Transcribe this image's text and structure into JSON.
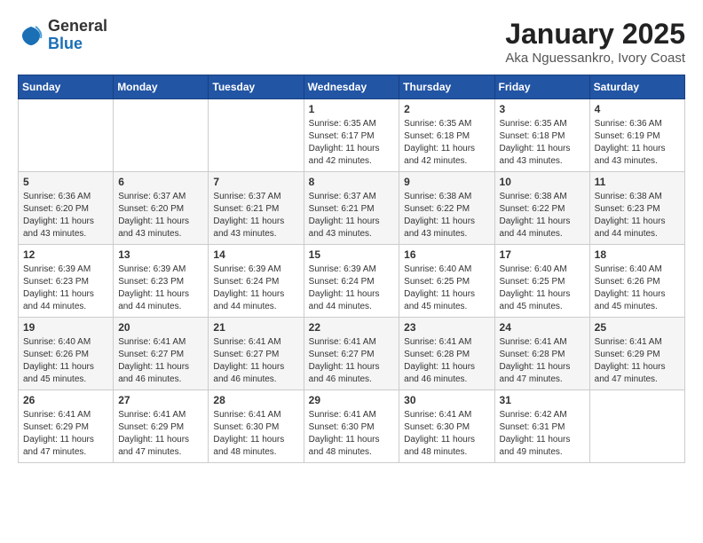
{
  "logo": {
    "general": "General",
    "blue": "Blue"
  },
  "title": "January 2025",
  "location": "Aka Nguessankro, Ivory Coast",
  "days_header": [
    "Sunday",
    "Monday",
    "Tuesday",
    "Wednesday",
    "Thursday",
    "Friday",
    "Saturday"
  ],
  "weeks": [
    [
      {
        "day": "",
        "info": ""
      },
      {
        "day": "",
        "info": ""
      },
      {
        "day": "",
        "info": ""
      },
      {
        "day": "1",
        "info": "Sunrise: 6:35 AM\nSunset: 6:17 PM\nDaylight: 11 hours\nand 42 minutes."
      },
      {
        "day": "2",
        "info": "Sunrise: 6:35 AM\nSunset: 6:18 PM\nDaylight: 11 hours\nand 42 minutes."
      },
      {
        "day": "3",
        "info": "Sunrise: 6:35 AM\nSunset: 6:18 PM\nDaylight: 11 hours\nand 43 minutes."
      },
      {
        "day": "4",
        "info": "Sunrise: 6:36 AM\nSunset: 6:19 PM\nDaylight: 11 hours\nand 43 minutes."
      }
    ],
    [
      {
        "day": "5",
        "info": "Sunrise: 6:36 AM\nSunset: 6:20 PM\nDaylight: 11 hours\nand 43 minutes."
      },
      {
        "day": "6",
        "info": "Sunrise: 6:37 AM\nSunset: 6:20 PM\nDaylight: 11 hours\nand 43 minutes."
      },
      {
        "day": "7",
        "info": "Sunrise: 6:37 AM\nSunset: 6:21 PM\nDaylight: 11 hours\nand 43 minutes."
      },
      {
        "day": "8",
        "info": "Sunrise: 6:37 AM\nSunset: 6:21 PM\nDaylight: 11 hours\nand 43 minutes."
      },
      {
        "day": "9",
        "info": "Sunrise: 6:38 AM\nSunset: 6:22 PM\nDaylight: 11 hours\nand 43 minutes."
      },
      {
        "day": "10",
        "info": "Sunrise: 6:38 AM\nSunset: 6:22 PM\nDaylight: 11 hours\nand 44 minutes."
      },
      {
        "day": "11",
        "info": "Sunrise: 6:38 AM\nSunset: 6:23 PM\nDaylight: 11 hours\nand 44 minutes."
      }
    ],
    [
      {
        "day": "12",
        "info": "Sunrise: 6:39 AM\nSunset: 6:23 PM\nDaylight: 11 hours\nand 44 minutes."
      },
      {
        "day": "13",
        "info": "Sunrise: 6:39 AM\nSunset: 6:23 PM\nDaylight: 11 hours\nand 44 minutes."
      },
      {
        "day": "14",
        "info": "Sunrise: 6:39 AM\nSunset: 6:24 PM\nDaylight: 11 hours\nand 44 minutes."
      },
      {
        "day": "15",
        "info": "Sunrise: 6:39 AM\nSunset: 6:24 PM\nDaylight: 11 hours\nand 44 minutes."
      },
      {
        "day": "16",
        "info": "Sunrise: 6:40 AM\nSunset: 6:25 PM\nDaylight: 11 hours\nand 45 minutes."
      },
      {
        "day": "17",
        "info": "Sunrise: 6:40 AM\nSunset: 6:25 PM\nDaylight: 11 hours\nand 45 minutes."
      },
      {
        "day": "18",
        "info": "Sunrise: 6:40 AM\nSunset: 6:26 PM\nDaylight: 11 hours\nand 45 minutes."
      }
    ],
    [
      {
        "day": "19",
        "info": "Sunrise: 6:40 AM\nSunset: 6:26 PM\nDaylight: 11 hours\nand 45 minutes."
      },
      {
        "day": "20",
        "info": "Sunrise: 6:41 AM\nSunset: 6:27 PM\nDaylight: 11 hours\nand 46 minutes."
      },
      {
        "day": "21",
        "info": "Sunrise: 6:41 AM\nSunset: 6:27 PM\nDaylight: 11 hours\nand 46 minutes."
      },
      {
        "day": "22",
        "info": "Sunrise: 6:41 AM\nSunset: 6:27 PM\nDaylight: 11 hours\nand 46 minutes."
      },
      {
        "day": "23",
        "info": "Sunrise: 6:41 AM\nSunset: 6:28 PM\nDaylight: 11 hours\nand 46 minutes."
      },
      {
        "day": "24",
        "info": "Sunrise: 6:41 AM\nSunset: 6:28 PM\nDaylight: 11 hours\nand 47 minutes."
      },
      {
        "day": "25",
        "info": "Sunrise: 6:41 AM\nSunset: 6:29 PM\nDaylight: 11 hours\nand 47 minutes."
      }
    ],
    [
      {
        "day": "26",
        "info": "Sunrise: 6:41 AM\nSunset: 6:29 PM\nDaylight: 11 hours\nand 47 minutes."
      },
      {
        "day": "27",
        "info": "Sunrise: 6:41 AM\nSunset: 6:29 PM\nDaylight: 11 hours\nand 47 minutes."
      },
      {
        "day": "28",
        "info": "Sunrise: 6:41 AM\nSunset: 6:30 PM\nDaylight: 11 hours\nand 48 minutes."
      },
      {
        "day": "29",
        "info": "Sunrise: 6:41 AM\nSunset: 6:30 PM\nDaylight: 11 hours\nand 48 minutes."
      },
      {
        "day": "30",
        "info": "Sunrise: 6:41 AM\nSunset: 6:30 PM\nDaylight: 11 hours\nand 48 minutes."
      },
      {
        "day": "31",
        "info": "Sunrise: 6:42 AM\nSunset: 6:31 PM\nDaylight: 11 hours\nand 49 minutes."
      },
      {
        "day": "",
        "info": ""
      }
    ]
  ]
}
